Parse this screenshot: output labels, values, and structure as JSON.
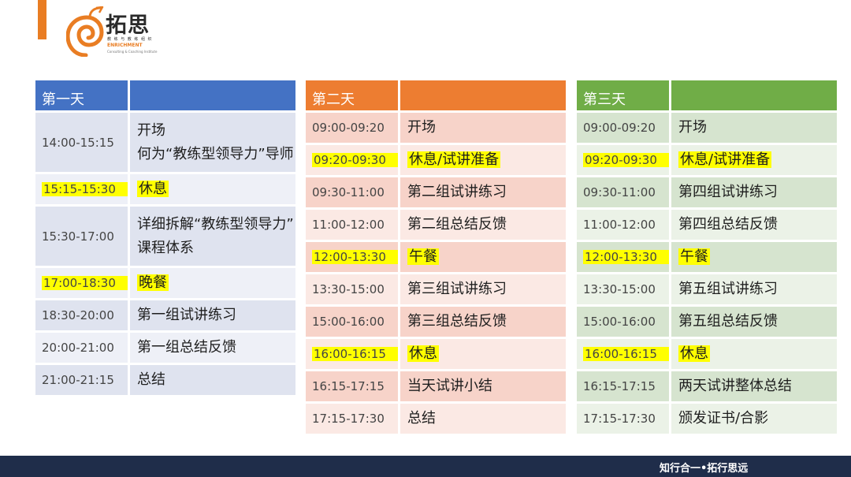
{
  "logo": {
    "cn": "拓思",
    "sub": "教 练 与 教 练 组 织",
    "en": "ENRICHMENT",
    "en2": "Consulting & Coaching Institute"
  },
  "colors": {
    "accent": "#e97d23",
    "day1_header": "#4472c4",
    "day2_header": "#ed7d31",
    "day3_header": "#70ad47",
    "highlight": "#ffff00",
    "footer": "#1f2d4a"
  },
  "days": [
    {
      "header": "第一天",
      "header_right": "",
      "rows": [
        {
          "time": "14:00-15:15",
          "lines": [
            "开场",
            "何为“教练型领导力”导师"
          ],
          "hl": false
        },
        {
          "time": "15:15-15:30",
          "lines": [
            "休息"
          ],
          "hl": true
        },
        {
          "time": "15:30-17:00",
          "lines": [
            "详细拆解“教练型领导力”",
            "课程体系"
          ],
          "hl": false
        },
        {
          "time": "17:00-18:30",
          "lines": [
            "晚餐"
          ],
          "hl": true
        },
        {
          "time": "18:30-20:00",
          "lines": [
            "第一组试讲练习"
          ],
          "hl": false
        },
        {
          "time": "20:00-21:00",
          "lines": [
            "第一组总结反馈"
          ],
          "hl": false
        },
        {
          "time": "21:00-21:15",
          "lines": [
            "总结"
          ],
          "hl": false
        }
      ]
    },
    {
      "header": "第二天",
      "header_right": "",
      "rows": [
        {
          "time": "09:00-09:20",
          "lines": [
            "开场"
          ],
          "hl": false
        },
        {
          "time": "09:20-09:30",
          "lines": [
            "休息/试讲准备"
          ],
          "hl": true
        },
        {
          "time": "09:30-11:00",
          "lines": [
            "第二组试讲练习"
          ],
          "hl": false
        },
        {
          "time": "11:00-12:00",
          "lines": [
            "第二组总结反馈"
          ],
          "hl": false
        },
        {
          "time": "12:00-13:30",
          "lines": [
            "午餐"
          ],
          "hl": true
        },
        {
          "time": "13:30-15:00",
          "lines": [
            "第三组试讲练习"
          ],
          "hl": false
        },
        {
          "time": "15:00-16:00",
          "lines": [
            "第三组总结反馈"
          ],
          "hl": false
        },
        {
          "time": "16:00-16:15",
          "lines": [
            "休息"
          ],
          "hl": true
        },
        {
          "time": "16:15-17:15",
          "lines": [
            "当天试讲小结"
          ],
          "hl": false
        },
        {
          "time": "17:15-17:30",
          "lines": [
            "总结"
          ],
          "hl": false
        }
      ]
    },
    {
      "header": "第三天",
      "header_right": "",
      "rows": [
        {
          "time": "09:00-09:20",
          "lines": [
            "开场"
          ],
          "hl": false
        },
        {
          "time": "09:20-09:30",
          "lines": [
            "休息/试讲准备"
          ],
          "hl": true
        },
        {
          "time": "09:30-11:00",
          "lines": [
            "第四组试讲练习"
          ],
          "hl": false
        },
        {
          "time": "11:00-12:00",
          "lines": [
            "第四组总结反馈"
          ],
          "hl": false
        },
        {
          "time": "12:00-13:30",
          "lines": [
            "午餐"
          ],
          "hl": true
        },
        {
          "time": "13:30-15:00",
          "lines": [
            "第五组试讲练习"
          ],
          "hl": false
        },
        {
          "time": "15:00-16:00",
          "lines": [
            "第五组总结反馈"
          ],
          "hl": false
        },
        {
          "time": "16:00-16:15",
          "lines": [
            "休息"
          ],
          "hl": true
        },
        {
          "time": "16:15-17:15",
          "lines": [
            "两天试讲整体总结"
          ],
          "hl": false
        },
        {
          "time": "17:15-17:30",
          "lines": [
            "颁发证书/合影"
          ],
          "hl": false
        }
      ]
    }
  ],
  "footer": {
    "slogan": "知行合一•拓行思远"
  }
}
